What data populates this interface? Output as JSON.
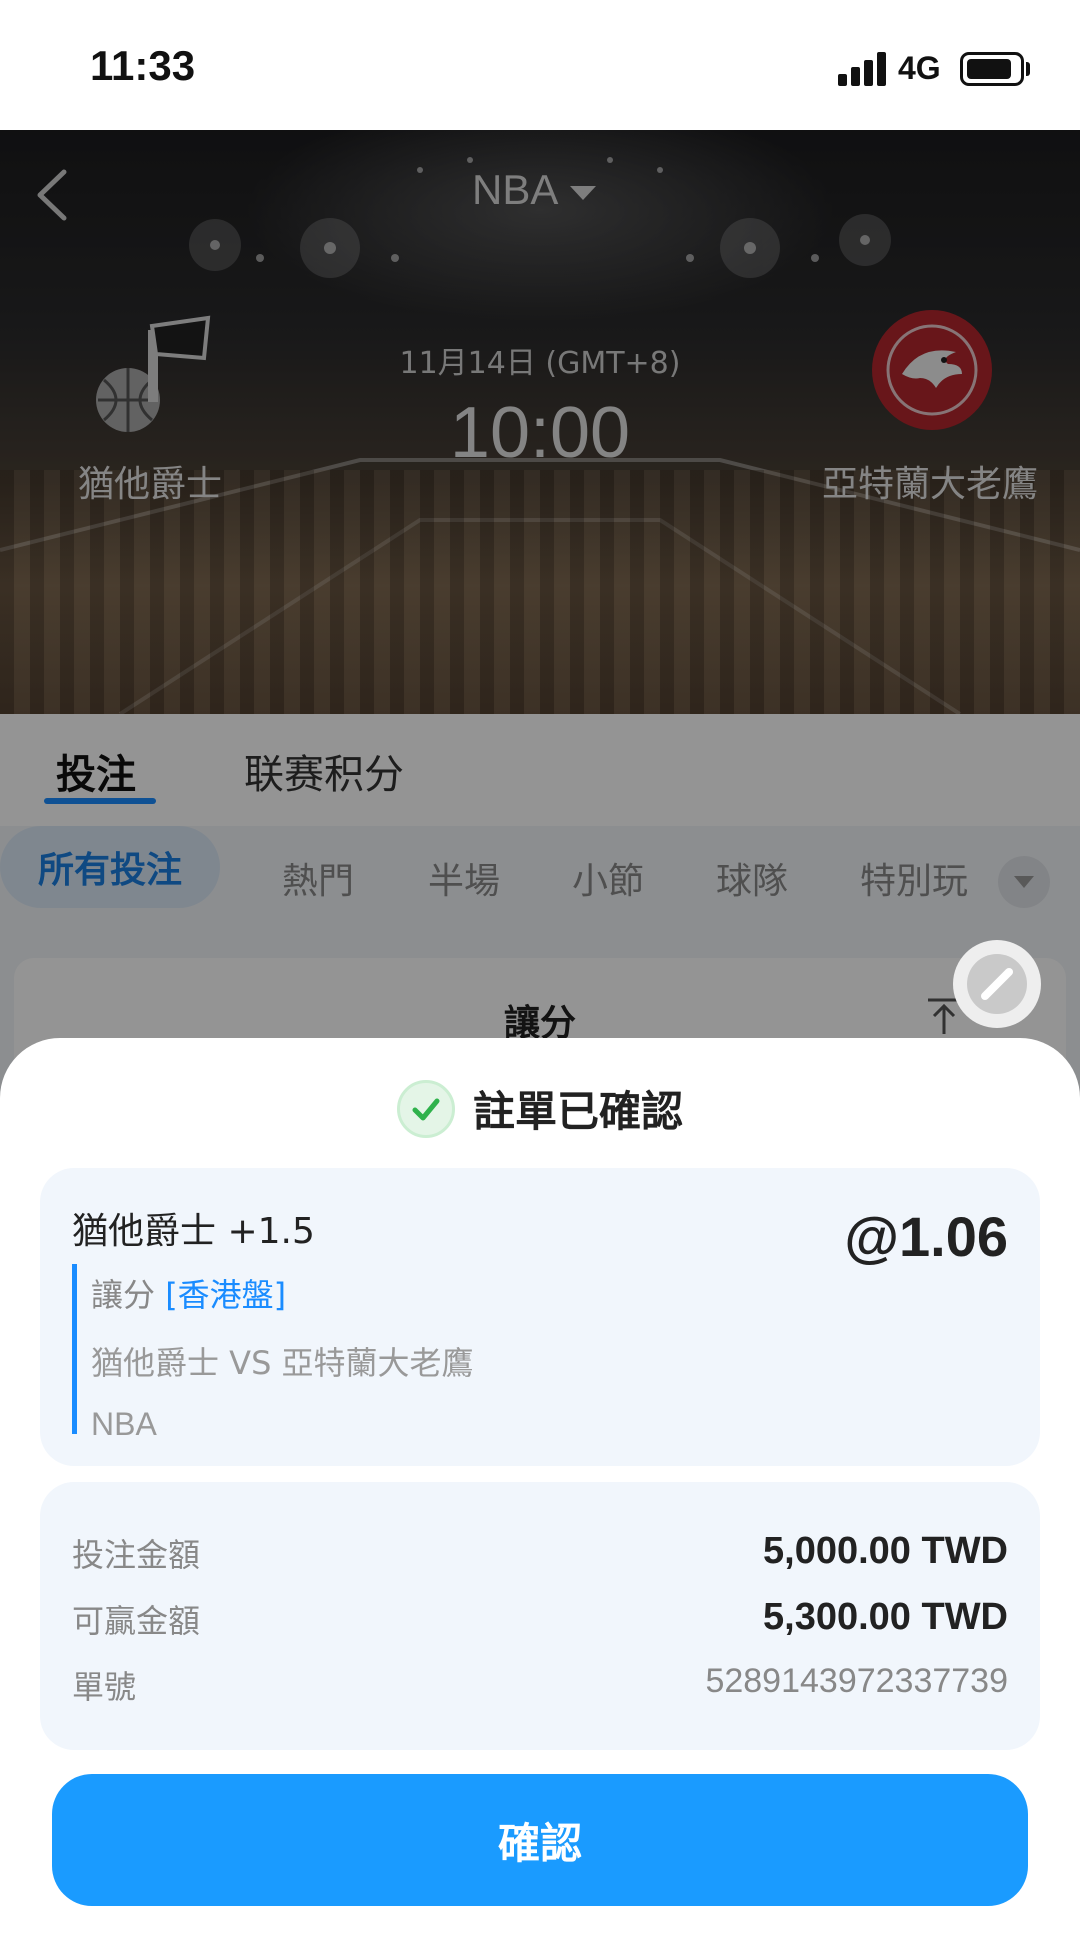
{
  "status_bar": {
    "time": "11:33",
    "network": "4G"
  },
  "header": {
    "league": "NBA"
  },
  "match": {
    "home_team": "猶他爵士",
    "away_team": "亞特蘭大老鷹",
    "date": "11月14日 (GMT+8)",
    "time": "10:00"
  },
  "tabs": [
    {
      "label": "投注",
      "active": true
    },
    {
      "label": "联赛积分",
      "active": false
    }
  ],
  "filter_chips": [
    {
      "label": "所有投注",
      "active": true
    },
    {
      "label": "熱門"
    },
    {
      "label": "半場"
    },
    {
      "label": "小節"
    },
    {
      "label": "球隊"
    },
    {
      "label": "特別玩"
    }
  ],
  "market_section": {
    "title": "讓分"
  },
  "confirmation": {
    "title": "註單已確認",
    "selection": "猶他爵士 +1.5",
    "odds": "@1.06",
    "market": "讓分",
    "market_type": "[香港盤]",
    "matchup": "猶他爵士 VS 亞特蘭大老鷹",
    "league": "NBA",
    "summary": [
      {
        "label": "投注金額",
        "value": "5,000.00 TWD"
      },
      {
        "label": "可贏金額",
        "value": "5,300.00 TWD"
      },
      {
        "label": "單號",
        "value": "5289143972337739"
      }
    ],
    "confirm_label": "確認"
  },
  "colors": {
    "accent": "#1a9bff",
    "success": "#2fb24c"
  }
}
